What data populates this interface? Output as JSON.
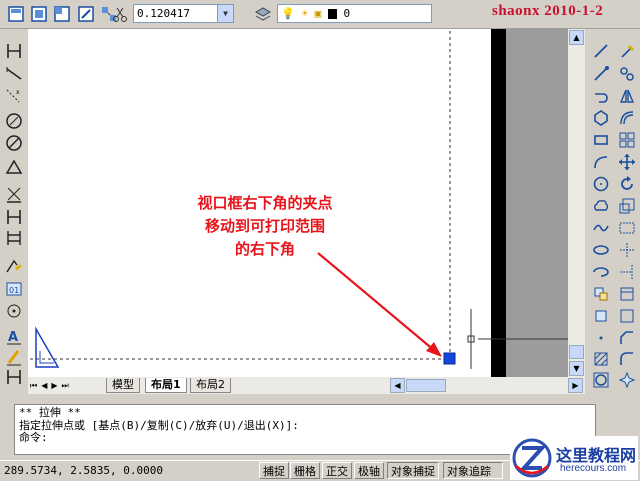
{
  "toolbar": {
    "ltscale_value": "0.120417",
    "layer_value": "0",
    "watermark": "shaonx 2010-1-2"
  },
  "tabs": [
    {
      "label": "模型",
      "active": false
    },
    {
      "label": "布局1",
      "active": true
    },
    {
      "label": "布局2",
      "active": false
    }
  ],
  "annotation": {
    "line1": "视口框右下角的夹点",
    "line2": "移动到可打印范围",
    "line3": "的右下角",
    "color": "#e8141b"
  },
  "command": {
    "line1": "** 拉伸 **",
    "line2": "指定拉伸点或 [基点(B)/复制(C)/放弃(U)/退出(X)]:",
    "line3": "命令:"
  },
  "status": {
    "coords": "289.5734, 2.5835, 0.0000",
    "buttons": [
      "捕捉",
      "栅格",
      "正交",
      "极轴",
      "对象捕捉",
      "对象追踪"
    ]
  },
  "logo": {
    "title": "这里教程网",
    "url": "herecours.com"
  },
  "icons": {
    "left": [
      "line-icon",
      "ray-icon",
      "xline-icon",
      "circle-icon",
      "circle-no-icon",
      "polygon-icon",
      "dim-aligned-icon",
      "dim-linear-icon",
      "dim-baseline-icon",
      "dim-edit-icon",
      "insert-block-icon",
      "point-icon",
      "text-icon",
      "edit-icon",
      "dim-continue-icon"
    ],
    "right1": [
      "line-icon",
      "polyline-icon",
      "arc-icon",
      "rectangle-icon",
      "hexagon-icon",
      "spline-icon",
      "circle-icon",
      "cloud-icon",
      "wave-icon",
      "ellipse-icon",
      "ellipse-arc-icon",
      "insert-icon",
      "block-icon",
      "point-icon",
      "hatch-icon",
      "region-icon"
    ],
    "right2": [
      "erase-icon",
      "copy-icon",
      "mirror-icon",
      "offset-icon",
      "array-icon",
      "move-icon",
      "rotate-icon",
      "scale-icon",
      "stretch-icon",
      "trim-icon",
      "extend-icon",
      "break-icon",
      "join-icon",
      "chamfer-icon",
      "fillet-icon",
      "explode-icon"
    ]
  }
}
